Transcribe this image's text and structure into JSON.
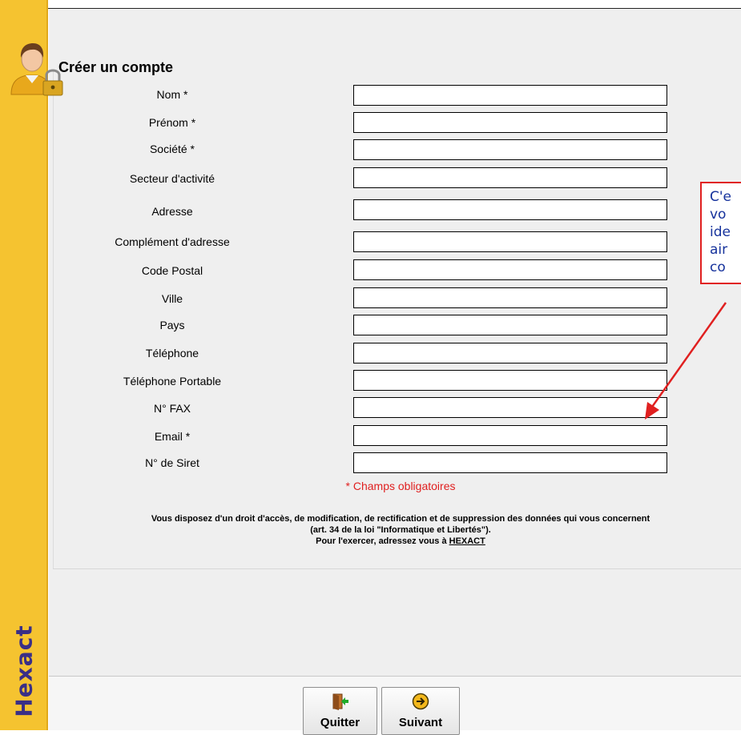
{
  "form": {
    "title": "Créer un compte",
    "fields": [
      {
        "label": "Nom *"
      },
      {
        "label": "Prénom *"
      },
      {
        "label": "Société *"
      },
      {
        "label": "Secteur d'activité"
      },
      {
        "label": "Adresse"
      },
      {
        "label": "Complément d'adresse"
      },
      {
        "label": "Code Postal"
      },
      {
        "label": "Ville"
      },
      {
        "label": "Pays"
      },
      {
        "label": "Téléphone"
      },
      {
        "label": "Téléphone Portable"
      },
      {
        "label": "N° FAX"
      },
      {
        "label": "Email *"
      },
      {
        "label": "N° de Siret"
      }
    ],
    "required_note": "* Champs obligatoires",
    "legal": {
      "line1": "Vous disposez d'un droit d'accès, de modification, de rectification et de suppression des données qui vous concernent",
      "line2": "(art. 34 de la loi \"Informatique et Libertés\").",
      "line3_prefix": "Pour l'exercer, adressez vous à",
      "link": "HEXACT"
    }
  },
  "tooltip": {
    "lines": [
      "C'e",
      "vo",
      "ide",
      "air",
      "co"
    ]
  },
  "buttons": {
    "quit": "Quitter",
    "next": "Suivant"
  },
  "brand": "Hexact",
  "icons": [
    "user-lock-icon",
    "exit-door-icon",
    "next-arrow-icon"
  ],
  "colors": {
    "sidebar": "#f5c330",
    "brand_text": "#3a2f86",
    "required": "#e02020",
    "tooltip_text": "#16329c"
  }
}
